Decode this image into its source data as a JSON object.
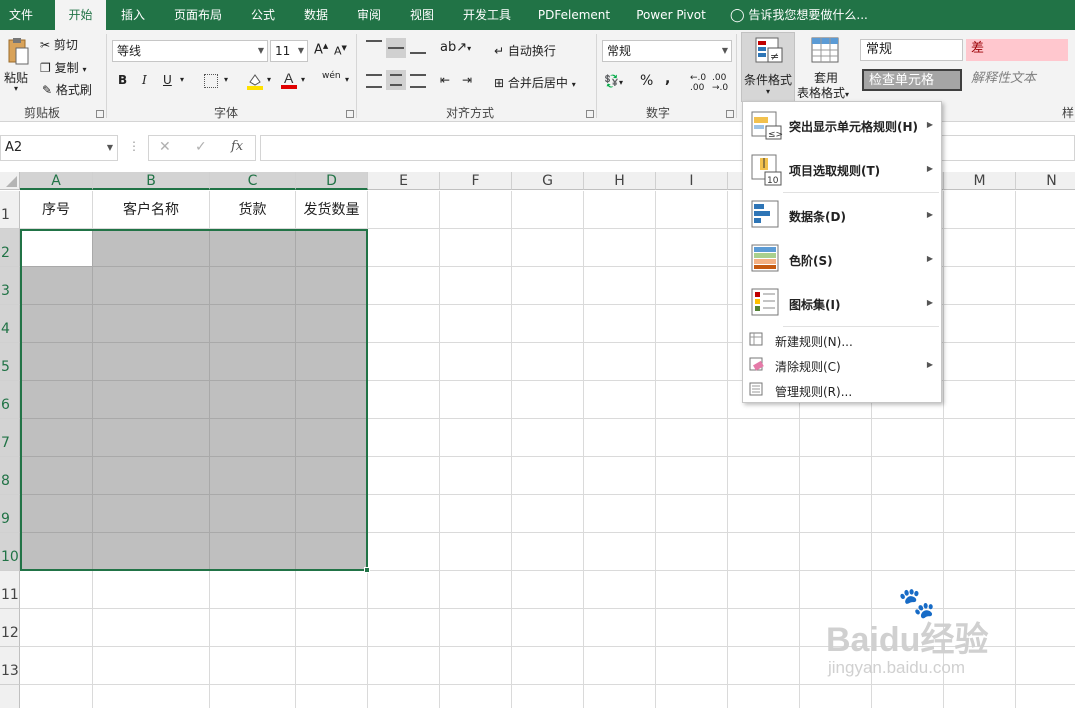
{
  "tabs": [
    {
      "label": "文件"
    },
    {
      "label": "开始"
    },
    {
      "label": "插入"
    },
    {
      "label": "页面布局"
    },
    {
      "label": "公式"
    },
    {
      "label": "数据"
    },
    {
      "label": "审阅"
    },
    {
      "label": "视图"
    },
    {
      "label": "开发工具"
    },
    {
      "label": "PDFelement"
    },
    {
      "label": "Power Pivot"
    }
  ],
  "tell_me": "告诉我您想要做什么...",
  "clipboard": {
    "paste": "粘贴",
    "cut": "剪切",
    "copy": "复制",
    "format_painter": "格式刷",
    "group": "剪贴板"
  },
  "font": {
    "name": "等线",
    "size": "11",
    "group": "字体",
    "bold": "B",
    "italic": "I",
    "underline": "U",
    "phonetic": "wén"
  },
  "alignment": {
    "wrap": "自动换行",
    "merge": "合并后居中",
    "group": "对齐方式"
  },
  "number": {
    "format": "常规",
    "percent": "%",
    "comma": ",",
    "group": "数字"
  },
  "styles": {
    "conditional": "条件格式",
    "table_l1": "套用",
    "table_l2": "表格格式",
    "normal": "常规",
    "bad": "差",
    "check": "检查单元格",
    "explanatory": "解释性文本",
    "group": "样"
  },
  "namebox": "A2",
  "fx": "fx",
  "columns": [
    "A",
    "B",
    "C",
    "D",
    "E",
    "F",
    "G",
    "H",
    "I",
    "M",
    "N"
  ],
  "rows": [
    "1",
    "2",
    "3",
    "4",
    "5",
    "6",
    "7",
    "8",
    "9",
    "10",
    "11",
    "12",
    "13"
  ],
  "headers": [
    "序号",
    "客户名称",
    "货款",
    "发货数量"
  ],
  "menu": {
    "items": [
      {
        "label": "突出显示单元格规则(H)",
        "icon": "highlight-rules-icon"
      },
      {
        "label": "项目选取规则(T)",
        "icon": "top-bottom-rules-icon"
      },
      {
        "label": "数据条(D)",
        "icon": "data-bars-icon"
      },
      {
        "label": "色阶(S)",
        "icon": "color-scales-icon"
      },
      {
        "label": "图标集(I)",
        "icon": "icon-sets-icon"
      },
      {
        "label": "新建规则(N)...",
        "icon": "new-rule-icon"
      },
      {
        "label": "清除规则(C)",
        "icon": "clear-rules-icon"
      },
      {
        "label": "管理规则(R)...",
        "icon": "manage-rules-icon"
      }
    ]
  },
  "watermark": {
    "brand": "Baidu经验",
    "url": "jingyan.baidu.com"
  },
  "colors": {
    "excel_green": "#217346",
    "selection_gray": "#bfbfbf",
    "bad_fill": "#ffc7ce",
    "bad_text": "#9c0006",
    "check_fill": "#a5a5a5"
  }
}
